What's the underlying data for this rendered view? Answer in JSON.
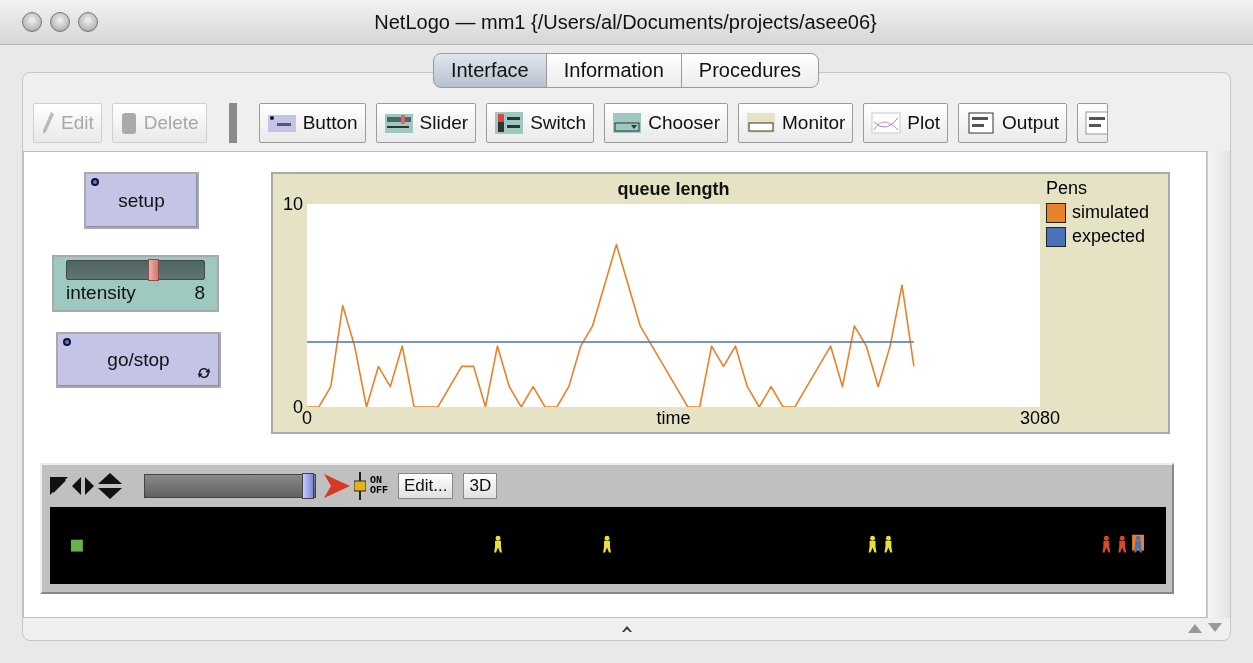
{
  "window": {
    "title": "NetLogo — mm1 {/Users/al/Documents/projects/asee06}"
  },
  "tabs": [
    {
      "label": "Interface",
      "selected": true
    },
    {
      "label": "Information",
      "selected": false
    },
    {
      "label": "Procedures",
      "selected": false
    }
  ],
  "toolbar": [
    {
      "kind": "edit",
      "label": "Edit",
      "disabled": true
    },
    {
      "kind": "delete",
      "label": "Delete",
      "disabled": true
    },
    {
      "kind": "separator"
    },
    {
      "kind": "button",
      "label": "Button",
      "disabled": false
    },
    {
      "kind": "slider",
      "label": "Slider",
      "disabled": false
    },
    {
      "kind": "switch",
      "label": "Switch",
      "disabled": false
    },
    {
      "kind": "chooser",
      "label": "Chooser",
      "disabled": false
    },
    {
      "kind": "monitor",
      "label": "Monitor",
      "disabled": false
    },
    {
      "kind": "plot",
      "label": "Plot",
      "disabled": false
    },
    {
      "kind": "output",
      "label": "Output",
      "disabled": false
    },
    {
      "kind": "note"
    }
  ],
  "widgets": [
    {
      "kind": "button",
      "label": "setup",
      "forever": false
    },
    {
      "kind": "slider",
      "label": "intensity",
      "value": "8",
      "level": 0.63
    },
    {
      "kind": "button",
      "label": "go/stop",
      "forever": true
    }
  ],
  "plot": {
    "chart_data": {
      "type": "line",
      "title": "queue length",
      "legend": {
        "title": "Pens"
      },
      "xlabel": "time",
      "xlim": [
        0,
        3080
      ],
      "ylim": [
        0,
        10
      ],
      "xticks": [
        0,
        3080
      ],
      "yticks": [
        0,
        10
      ],
      "x": [
        0,
        50,
        100,
        150,
        200,
        250,
        300,
        350,
        400,
        450,
        500,
        550,
        600,
        650,
        700,
        750,
        800,
        850,
        900,
        950,
        1000,
        1050,
        1100,
        1150,
        1200,
        1250,
        1300,
        1350,
        1400,
        1450,
        1500,
        1550,
        1600,
        1650,
        1700,
        1750,
        1800,
        1850,
        1900,
        1950,
        2000,
        2050,
        2100,
        2150,
        2200,
        2250,
        2300,
        2350,
        2400,
        2450,
        2500,
        2550
      ],
      "series": [
        {
          "name": "simulated",
          "color": "#e8822a",
          "values": [
            0,
            0,
            1,
            5,
            3,
            0,
            2,
            1,
            3,
            0,
            0,
            0,
            1,
            2,
            2,
            0,
            3,
            1,
            0,
            1,
            0,
            0,
            1,
            3,
            4,
            6,
            8,
            6,
            4,
            3,
            2,
            1,
            0,
            0,
            3,
            2,
            3,
            1,
            0,
            1,
            0,
            0,
            1,
            2,
            3,
            1,
            4,
            3,
            1,
            3,
            6,
            2
          ]
        },
        {
          "name": "expected",
          "color": "#4a72b8",
          "values": [
            3.2,
            3.2,
            3.2,
            3.2,
            3.2,
            3.2,
            3.2,
            3.2,
            3.2,
            3.2,
            3.2,
            3.2,
            3.2,
            3.2,
            3.2,
            3.2,
            3.2,
            3.2,
            3.2,
            3.2,
            3.2,
            3.2,
            3.2,
            3.2,
            3.2,
            3.2,
            3.2,
            3.2,
            3.2,
            3.2,
            3.2,
            3.2,
            3.2,
            3.2,
            3.2,
            3.2,
            3.2,
            3.2,
            3.2,
            3.2,
            3.2,
            3.2,
            3.2,
            3.2,
            3.2,
            3.2,
            3.2,
            3.2,
            3.2,
            3.2,
            3.2,
            3.2
          ]
        }
      ]
    }
  },
  "view_toolbar": {
    "speed_slider": {
      "level": 0.97
    },
    "update_switch": {
      "on_label": "ON",
      "off_label": "OFF"
    },
    "buttons": [
      "Edit...",
      "3D"
    ]
  }
}
